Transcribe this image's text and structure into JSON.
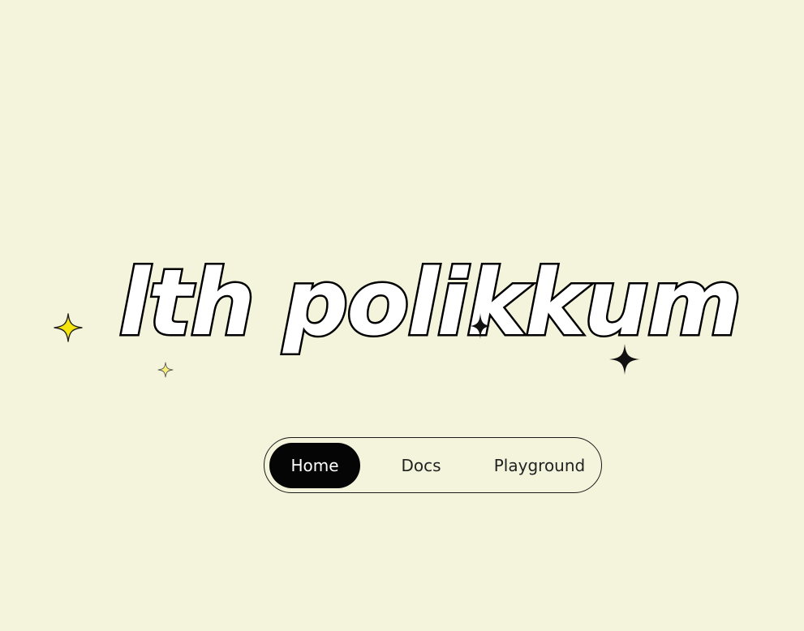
{
  "hero": {
    "title": "lth polikkum"
  },
  "decorations": {
    "sparkles": [
      {
        "icon": "sparkle-icon",
        "fill": "#f5e50f"
      },
      {
        "icon": "sparkle-icon",
        "fill": "#f5e50f"
      },
      {
        "icon": "sparkle-icon",
        "fill": "#111111"
      },
      {
        "icon": "sparkle-icon",
        "fill": "#111111"
      }
    ]
  },
  "nav": {
    "items": [
      {
        "label": "Home",
        "active": true
      },
      {
        "label": "Docs",
        "active": false
      },
      {
        "label": "Playground",
        "active": false
      }
    ]
  },
  "colors": {
    "background": "#f4f4dc",
    "accent_yellow": "#f5e50f",
    "ink": "#050505"
  }
}
